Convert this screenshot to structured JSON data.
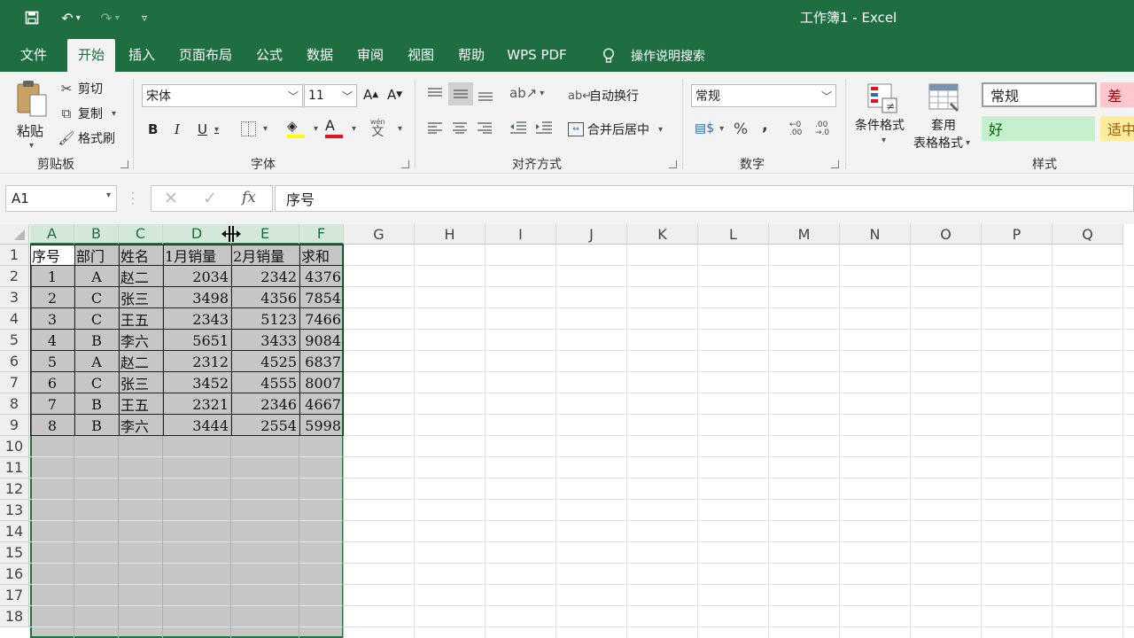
{
  "window": {
    "title": "工作簿1 - Excel"
  },
  "menu": {
    "tabs": [
      "文件",
      "开始",
      "插入",
      "页面布局",
      "公式",
      "数据",
      "审阅",
      "视图",
      "帮助",
      "WPS PDF"
    ],
    "active": "开始",
    "search": "操作说明搜索"
  },
  "ribbon": {
    "clipboard": {
      "paste": "粘贴",
      "cut": "剪切",
      "copy": "复制",
      "format_painter": "格式刷",
      "label": "剪贴板"
    },
    "font": {
      "name": "宋体",
      "size": "11",
      "label": "字体",
      "bold": "B",
      "italic": "I",
      "underline": "U",
      "phonetic": "wén"
    },
    "alignment": {
      "wrap": "自动换行",
      "merge": "合并后居中",
      "label": "对齐方式"
    },
    "number": {
      "format": "常规",
      "percent": "%",
      "comma": ",",
      "label": "数字"
    },
    "styles": {
      "conditional": "条件格式",
      "table_line1": "套用",
      "table_line2": "表格格式",
      "normal": "常规",
      "bad": "差",
      "good": "好",
      "neutral": "适中",
      "label": "样式"
    }
  },
  "formula_bar": {
    "name_box": "A1",
    "content": "序号"
  },
  "grid": {
    "columns": [
      "A",
      "B",
      "C",
      "D",
      "E",
      "F",
      "G",
      "H",
      "I",
      "J",
      "K",
      "L",
      "M",
      "N",
      "O",
      "P",
      "Q"
    ],
    "rows": [
      "1",
      "2",
      "3",
      "4",
      "5",
      "6",
      "7",
      "8",
      "9",
      "10",
      "11",
      "12",
      "13",
      "14",
      "15",
      "16",
      "17",
      "18"
    ],
    "headers": [
      "序号",
      "部门",
      "姓名",
      "1月销量",
      "2月销量",
      "求和"
    ],
    "data": [
      [
        "1",
        "A",
        "赵二",
        "2034",
        "2342",
        "4376"
      ],
      [
        "2",
        "C",
        "张三",
        "3498",
        "4356",
        "7854"
      ],
      [
        "3",
        "C",
        "王五",
        "2343",
        "5123",
        "7466"
      ],
      [
        "4",
        "B",
        "李六",
        "5651",
        "3433",
        "9084"
      ],
      [
        "5",
        "A",
        "赵二",
        "2312",
        "4525",
        "6837"
      ],
      [
        "6",
        "C",
        "张三",
        "3452",
        "4555",
        "8007"
      ],
      [
        "7",
        "B",
        "王五",
        "2321",
        "2346",
        "4667"
      ],
      [
        "8",
        "B",
        "李六",
        "3444",
        "2554",
        "5998"
      ]
    ]
  },
  "colors": {
    "accent": "#1e6e42",
    "selection": "#c6c6c6",
    "header_selected": "#d3e8d9"
  }
}
